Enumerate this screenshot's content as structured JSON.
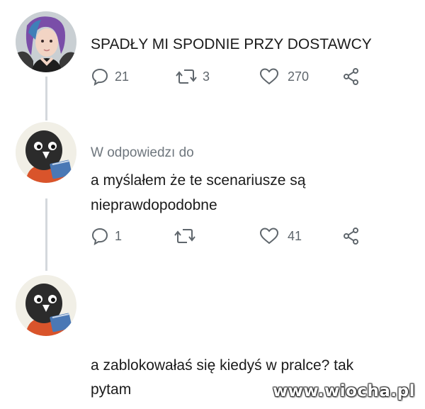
{
  "tweets": [
    {
      "avatar": "girl-purple-hair-avatar",
      "text": "SPADŁY MI SPODNIE PRZY DOSTAWCY",
      "reply_count": "21",
      "retweet_count": "3",
      "like_count": "270"
    },
    {
      "avatar": "bird-reading-book-avatar",
      "reply_label": "W odpowiedzı do",
      "text_line1": "a myślałem że te scenariusze są",
      "text_line2": "nieprawdopodobne",
      "reply_count": "1",
      "retweet_count": "",
      "like_count": "41"
    },
    {
      "avatar": "bird-reading-book-avatar",
      "text_line1": "a zablokowałaś się kiedyś w pralce? tak",
      "text_line2": "pytam"
    }
  ],
  "icons": {
    "reply": "speech-bubble-icon",
    "retweet": "retweet-arrows-icon",
    "like": "heart-icon",
    "share": "share-icon"
  },
  "watermark": "www.wiocha.pl",
  "colors": {
    "icon_gray": "#5f666c",
    "thread_line": "#d4d8dc",
    "reply_label": "#6e767d",
    "bird_body": "#2b2b2b",
    "bird_shirt": "#d9542b",
    "book_blue": "#4a78b5",
    "avatar_bg": "#f1efe6"
  }
}
